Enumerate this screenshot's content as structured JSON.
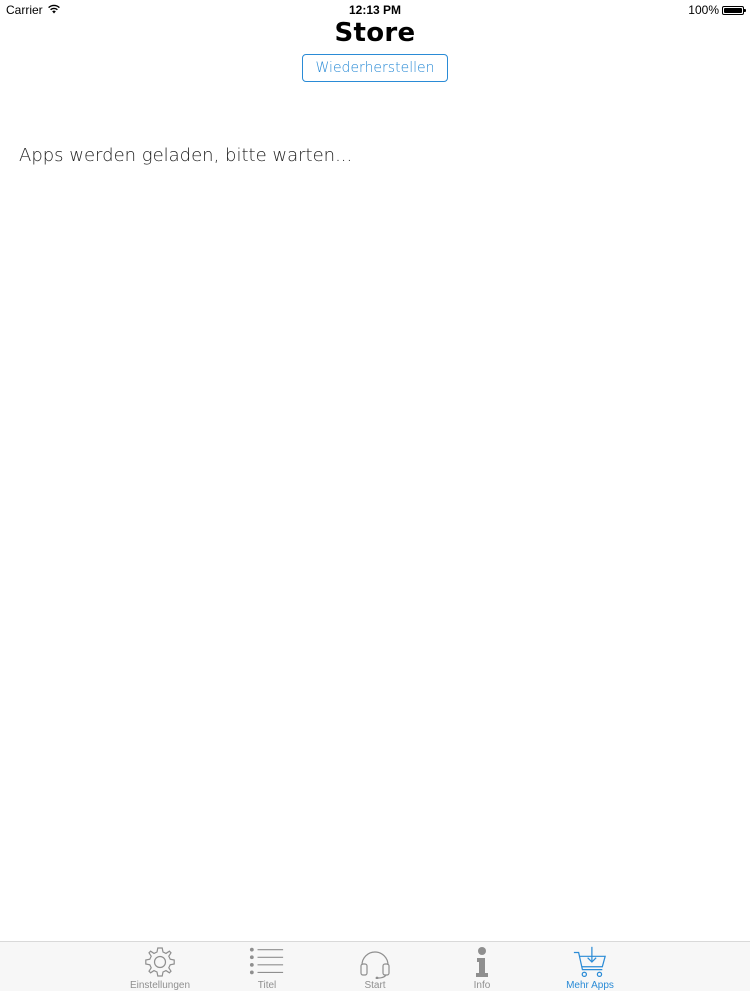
{
  "status_bar": {
    "carrier": "Carrier",
    "time": "12:13 PM",
    "battery": "100%"
  },
  "header": {
    "title": "Store",
    "restore_label": "Wiederherstellen"
  },
  "main": {
    "loading_text": "Apps werden geladen, bitte warten..."
  },
  "tab_bar": {
    "tabs": [
      {
        "label": "Einstellungen",
        "icon": "gear-icon",
        "active": false
      },
      {
        "label": "Titel",
        "icon": "list-icon",
        "active": false
      },
      {
        "label": "Start",
        "icon": "headphones-icon",
        "active": false
      },
      {
        "label": "Info",
        "icon": "info-icon",
        "active": false
      },
      {
        "label": "Mehr Apps",
        "icon": "cart-download-icon",
        "active": true
      }
    ],
    "colors": {
      "active": "#2a8bd6",
      "inactive": "#8f8f8f"
    }
  }
}
